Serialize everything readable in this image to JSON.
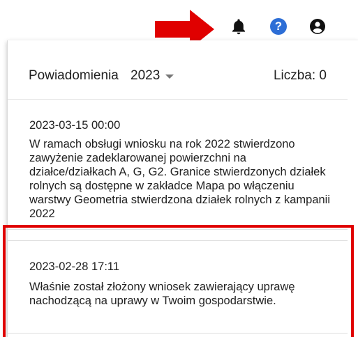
{
  "icons": {
    "bell": "bell-icon",
    "help": "help-icon",
    "account": "account-icon",
    "arrow": "red-arrow"
  },
  "colors": {
    "accent_help": "#2d6ed6",
    "arrow": "#e00000",
    "highlight": "#e00000"
  },
  "help_glyph": "?",
  "notifications_panel": {
    "title": "Powiadomienia",
    "year": "2023",
    "count_label": "Liczba: 0",
    "items": [
      {
        "date": "2023-03-15 00:00",
        "text": "W ramach obsługi wniosku na rok 2022 stwierdzono zawyżenie zadeklarowanej powierzchni na działce/działkach A, G, G2. Granice stwierdzonych działek rolnych są dostępne w zakładce Mapa po włączeniu warstwy Geometria stwierdzona działek rolnych z kampanii 2022"
      },
      {
        "date": "2023-02-28 17:11",
        "text": "Właśnie został złożony wniosek zawierający uprawę nachodzącą na uprawy w Twoim gospodarstwie."
      }
    ]
  }
}
